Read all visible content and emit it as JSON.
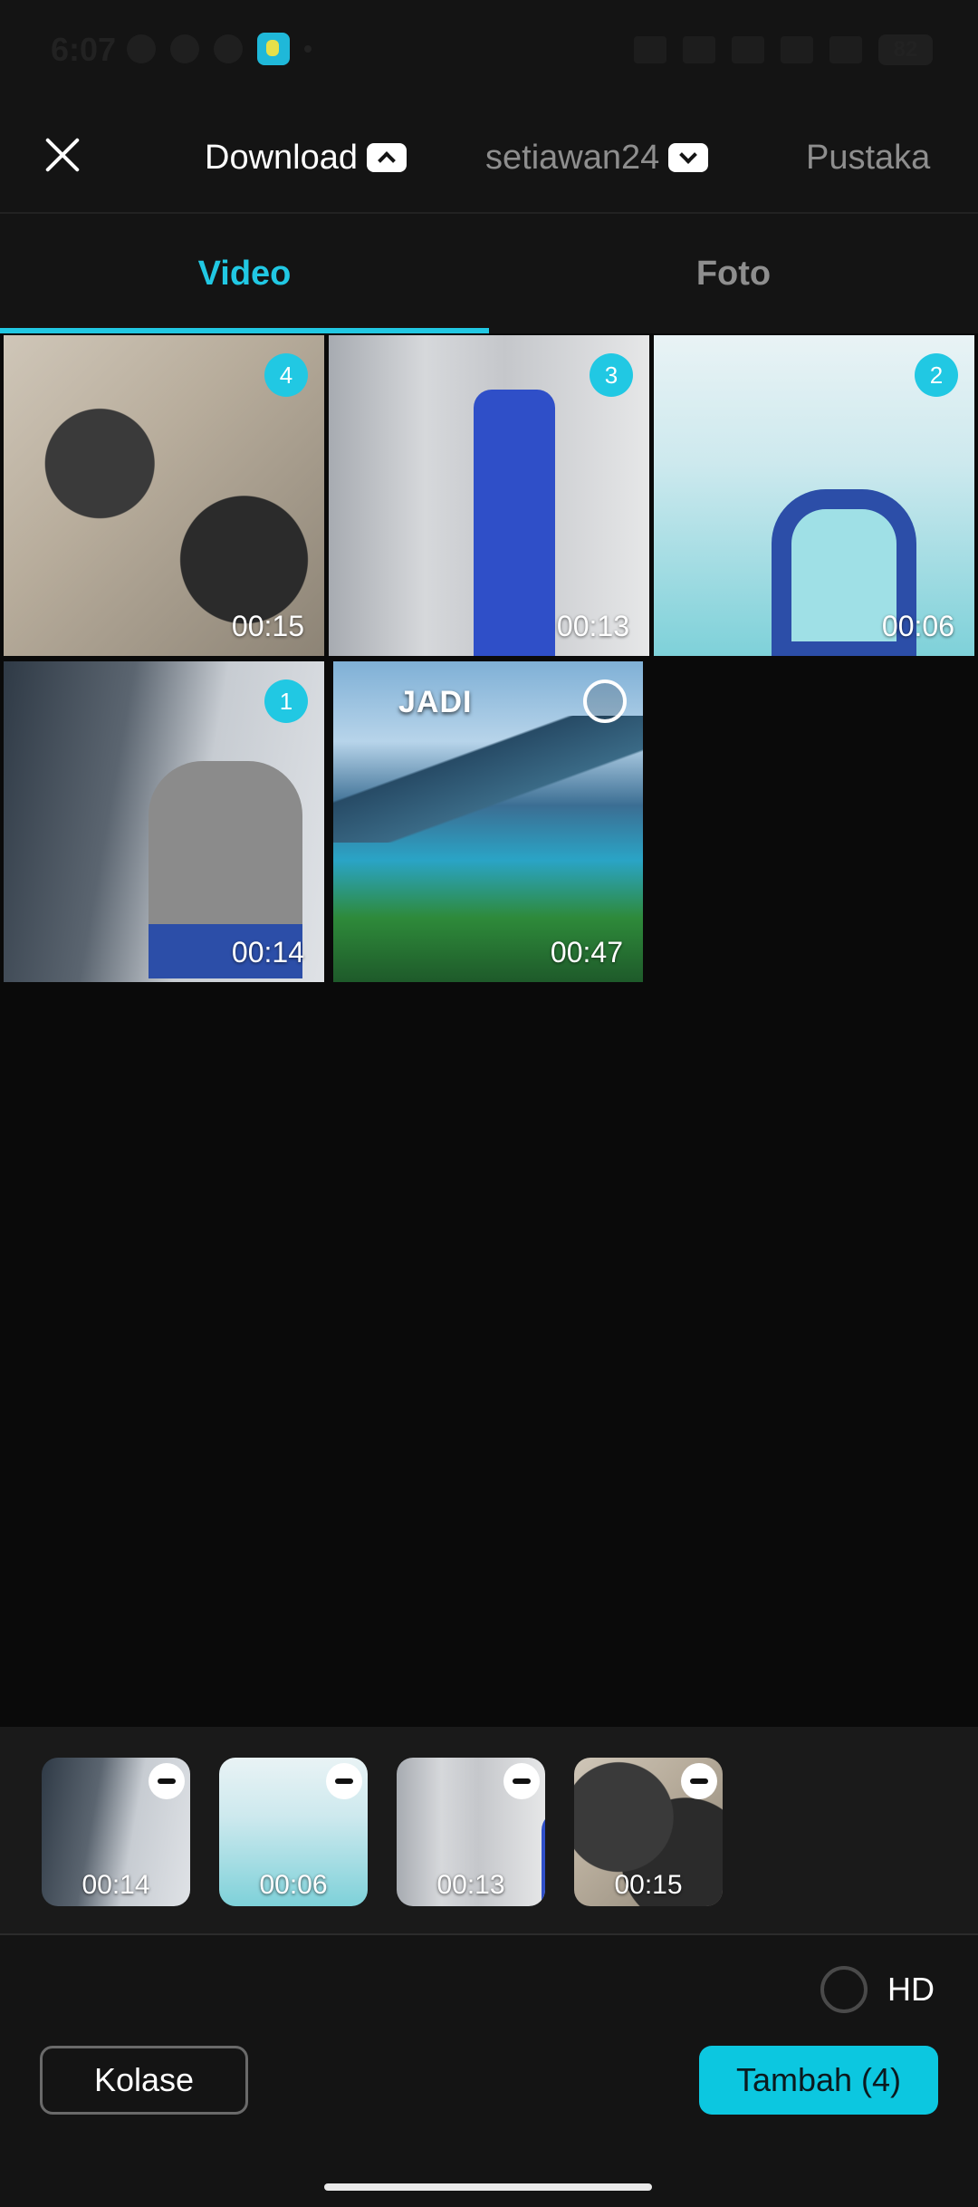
{
  "status_bar": {
    "time": "6:07",
    "battery": "82"
  },
  "header": {
    "source_download": "Download",
    "source_account": "setiawan24",
    "source_library": "Pustaka"
  },
  "tabs": {
    "video": "Video",
    "photo": "Foto",
    "active": "Video"
  },
  "media_grid": [
    {
      "duration": "00:15",
      "selection_order": "4",
      "selected": true,
      "scene": "electronics-workbench"
    },
    {
      "duration": "00:13",
      "selection_order": "3",
      "selected": true,
      "scene": "technician-at-fridge"
    },
    {
      "duration": "00:06",
      "selection_order": "2",
      "selected": true,
      "scene": "technician-at-ac-unit"
    },
    {
      "duration": "00:14",
      "selection_order": "1",
      "selected": true,
      "scene": "technician-writing-at-desk"
    },
    {
      "duration": "00:47",
      "selection_order": "",
      "selected": false,
      "scene": "mountain-lake-landscape",
      "overlay_text": "JADI"
    }
  ],
  "selected_tray": [
    {
      "duration": "00:14"
    },
    {
      "duration": "00:06"
    },
    {
      "duration": "00:13"
    },
    {
      "duration": "00:15"
    }
  ],
  "bottom_bar": {
    "hd_label": "HD",
    "hd_checked": false,
    "collage_label": "Kolase",
    "add_label": "Tambah (4)"
  },
  "colors": {
    "accent": "#21c8e3",
    "background": "#0a0a0a",
    "surface": "#141414"
  }
}
